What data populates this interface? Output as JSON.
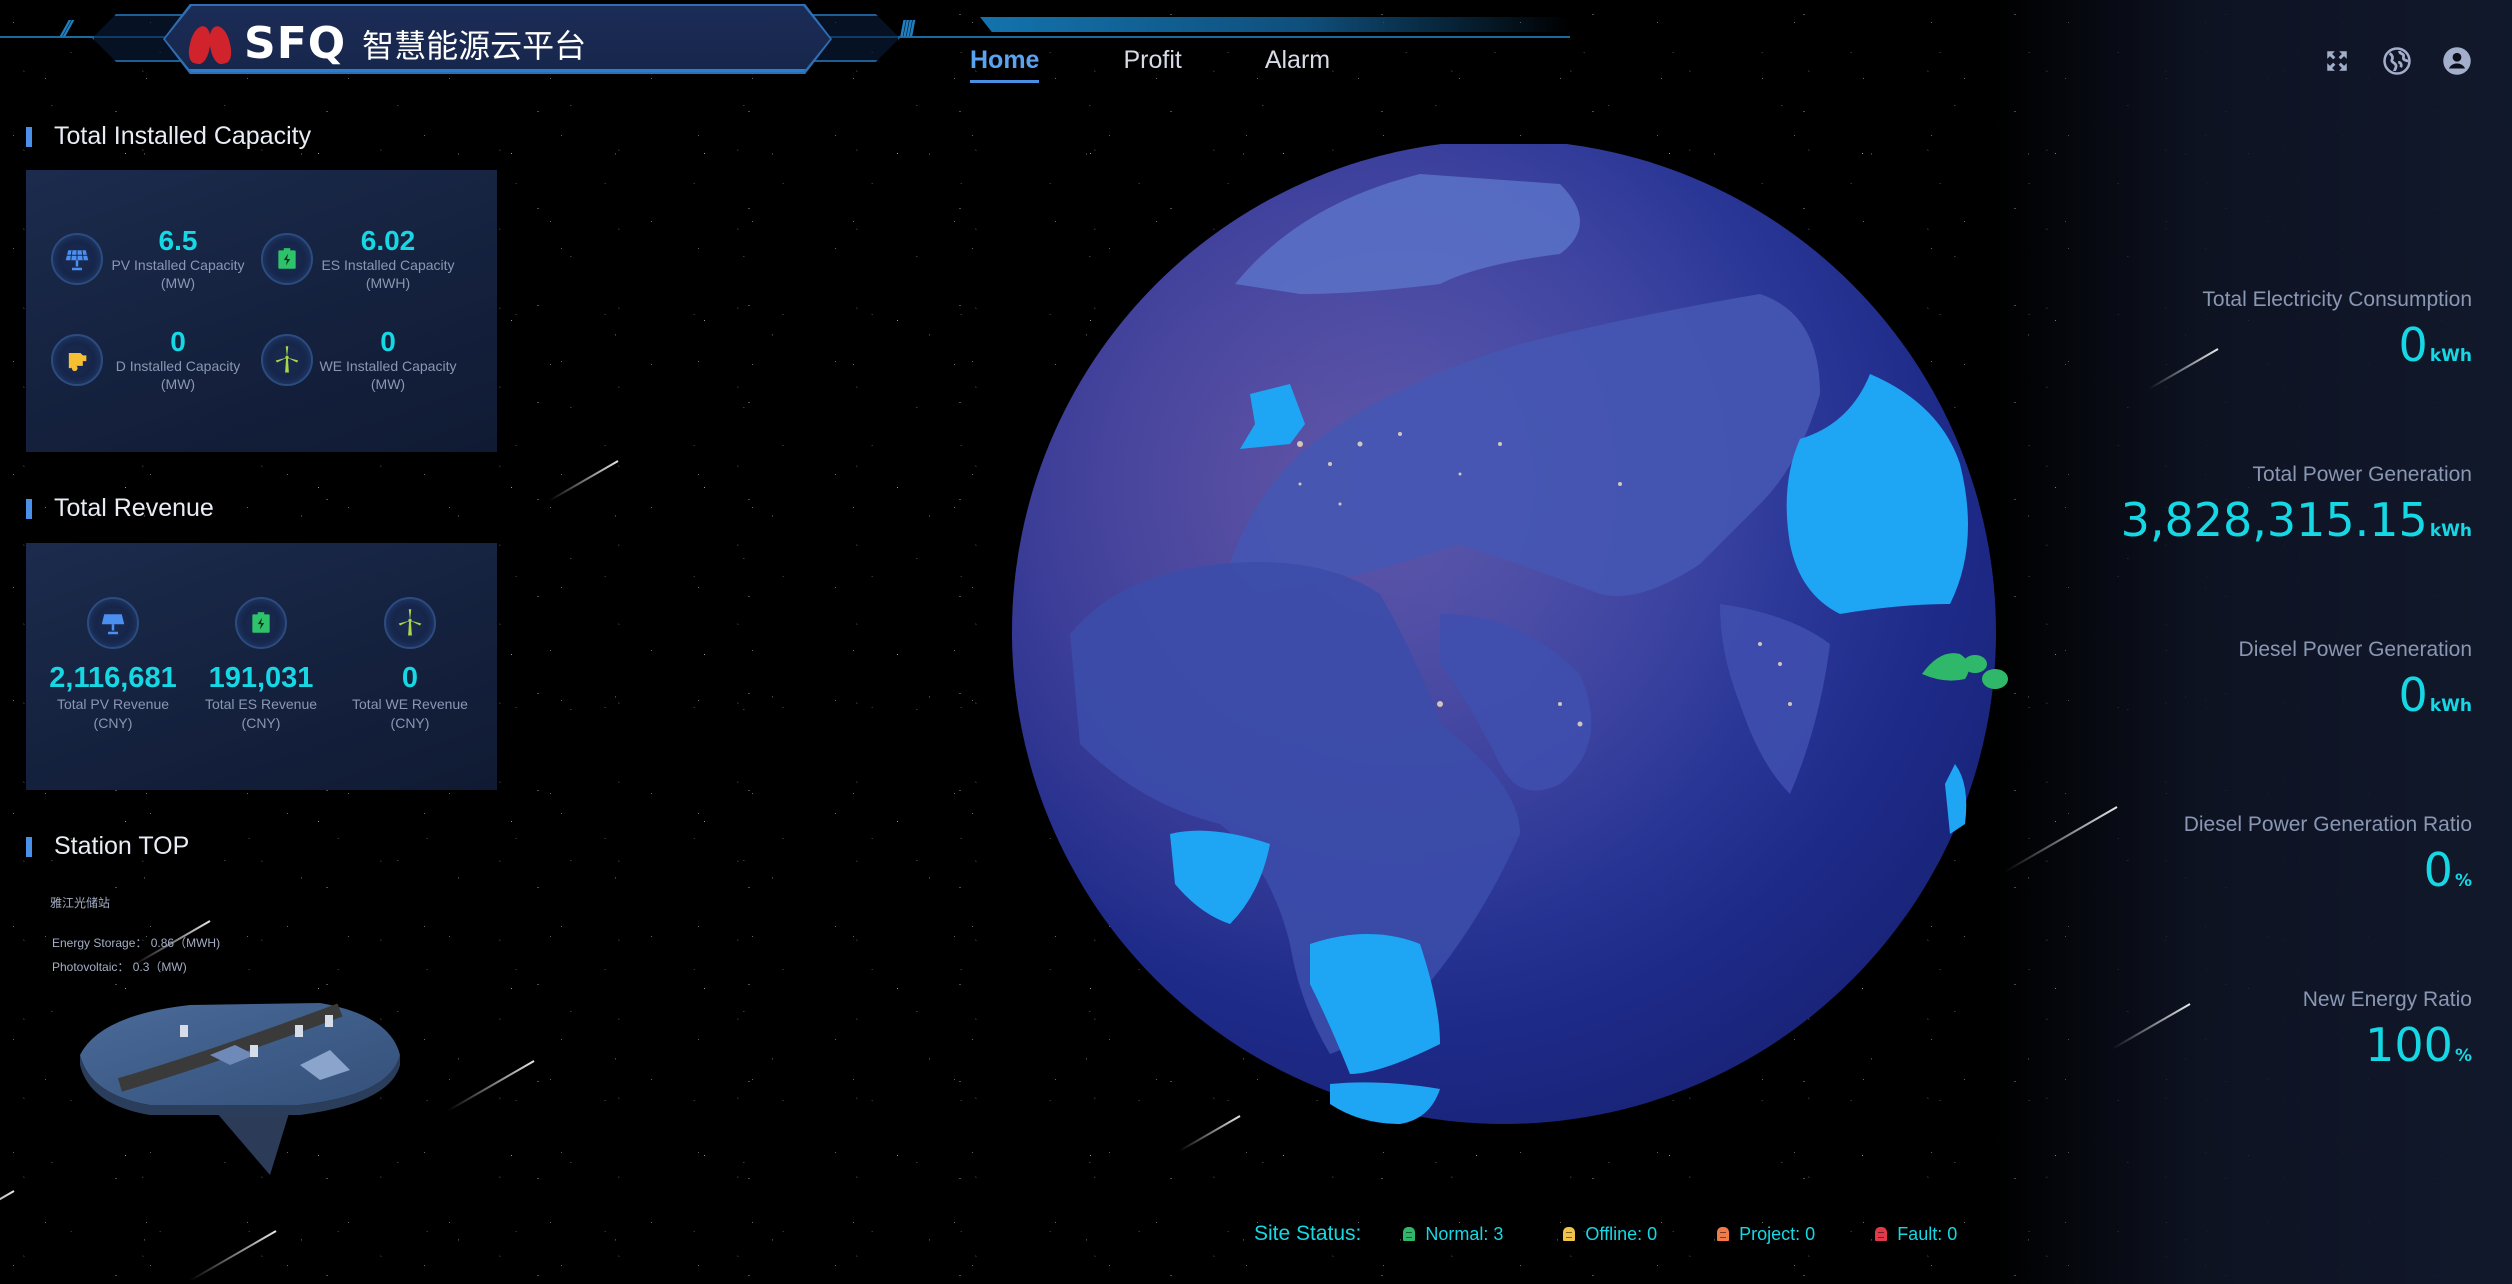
{
  "header": {
    "logo_brand": "SFQ",
    "logo_subtitle": "智慧能源云平台",
    "nav": [
      {
        "label": "Home",
        "active": true
      },
      {
        "label": "Profit",
        "active": false
      },
      {
        "label": "Alarm",
        "active": false
      }
    ],
    "icons": [
      "fullscreen-icon",
      "globe-language-icon",
      "user-account-icon"
    ]
  },
  "installed_capacity": {
    "title": "Total Installed Capacity",
    "items": [
      {
        "icon": "solar-panel-icon",
        "value": "6.5",
        "label": "PV Installed Capacity",
        "unit": "(MW)"
      },
      {
        "icon": "battery-storage-icon",
        "value": "6.02",
        "label": "ES Installed Capacity",
        "unit": "(MWH)"
      },
      {
        "icon": "diesel-generator-icon",
        "value": "0",
        "label": "D Installed Capacity",
        "unit": "(MW)"
      },
      {
        "icon": "wind-turbine-icon",
        "value": "0",
        "label": "WE Installed Capacity",
        "unit": "(MW)"
      }
    ]
  },
  "revenue": {
    "title": "Total Revenue",
    "items": [
      {
        "icon": "solar-panel-icon",
        "value": "2,116,681",
        "label": "Total PV Revenue",
        "unit": "(CNY)"
      },
      {
        "icon": "battery-storage-icon",
        "value": "191,031",
        "label": "Total ES Revenue",
        "unit": "(CNY)"
      },
      {
        "icon": "wind-turbine-icon",
        "value": "0",
        "label": "Total WE Revenue",
        "unit": "(CNY)"
      }
    ]
  },
  "station_top": {
    "title": "Station TOP",
    "station_name": "雅江光储站",
    "energy_storage": "Energy Storage： 0.86（MWH)",
    "photovoltaic": "Photovoltaic： 0.3（MW)"
  },
  "stats": [
    {
      "label": "Total Electricity Consumption",
      "value": "0",
      "unit": "kWh"
    },
    {
      "label": "Total Power Generation",
      "value": "3,828,315.15",
      "unit": "kWh"
    },
    {
      "label": "Diesel Power Generation",
      "value": "0",
      "unit": "kWh"
    },
    {
      "label": "Diesel Power Generation Ratio",
      "value": "0",
      "unit": "%"
    },
    {
      "label": "New Energy Ratio",
      "value": "100",
      "unit": "%"
    }
  ],
  "site_status": {
    "label": "Site Status:",
    "items": [
      {
        "name": "Normal",
        "text": "Normal:  3",
        "count": 3,
        "color": "#2fb86a"
      },
      {
        "name": "Offline",
        "text": "Offline:  0",
        "count": 0,
        "color": "#f0c24a"
      },
      {
        "name": "Project",
        "text": "Project:  0",
        "count": 0,
        "color": "#f07a4a"
      },
      {
        "name": "Fault",
        "text": "Fault:  0",
        "count": 0,
        "color": "#e03a4a"
      }
    ]
  },
  "colors": {
    "accent_cyan": "#16d8e4",
    "nav_active": "#5aa2f2",
    "section_bar": "#4a8fe8",
    "highlight_country": "#1ea6f5",
    "station_marker": "#2fb86a"
  }
}
